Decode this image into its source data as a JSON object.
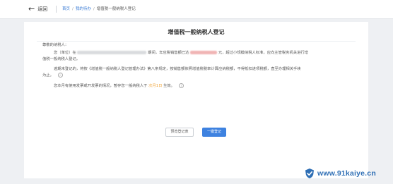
{
  "header": {
    "back_label": "返回",
    "breadcrumb": [
      "首页",
      "我的待办",
      "增值税一般纳税人登记"
    ]
  },
  "card": {
    "title": "增值税一般纳税人登记",
    "greeting": "尊敬的纳税人：",
    "p1_prefix": "您（单位）在",
    "p1_mid": "期间，年应税销售额已达",
    "p1_suffix": "元，超过小规模纳税人标准，应向主管税务机关进行增",
    "p1_line2": "值税一般纳税人登记。",
    "p2_line1": "逾期未登记的，将按《增值税一般纳税人登记管理办法》第八条规定，按销售额依照增值税税率计算应纳税额，不得抵扣进项税额，直至办理相关手续",
    "p2_line2": "为止。",
    "p3_prefix": "您本月有使用发票或开发票的情况，暂存您一般纳税人于",
    "p3_highlight": "次月1日",
    "p3_suffix": "生效。"
  },
  "buttons": {
    "preview": "预览登记表",
    "register": "一键登记"
  },
  "watermark": {
    "text": "www.91kaiye.cn"
  },
  "colors": {
    "accent": "#3e82e0",
    "highlight": "#f0a030",
    "redacted_amount": "#f0b4b4"
  },
  "icons": {
    "back": "arrow-left-icon",
    "info": "info-icon",
    "watermark": "shield-icon"
  }
}
